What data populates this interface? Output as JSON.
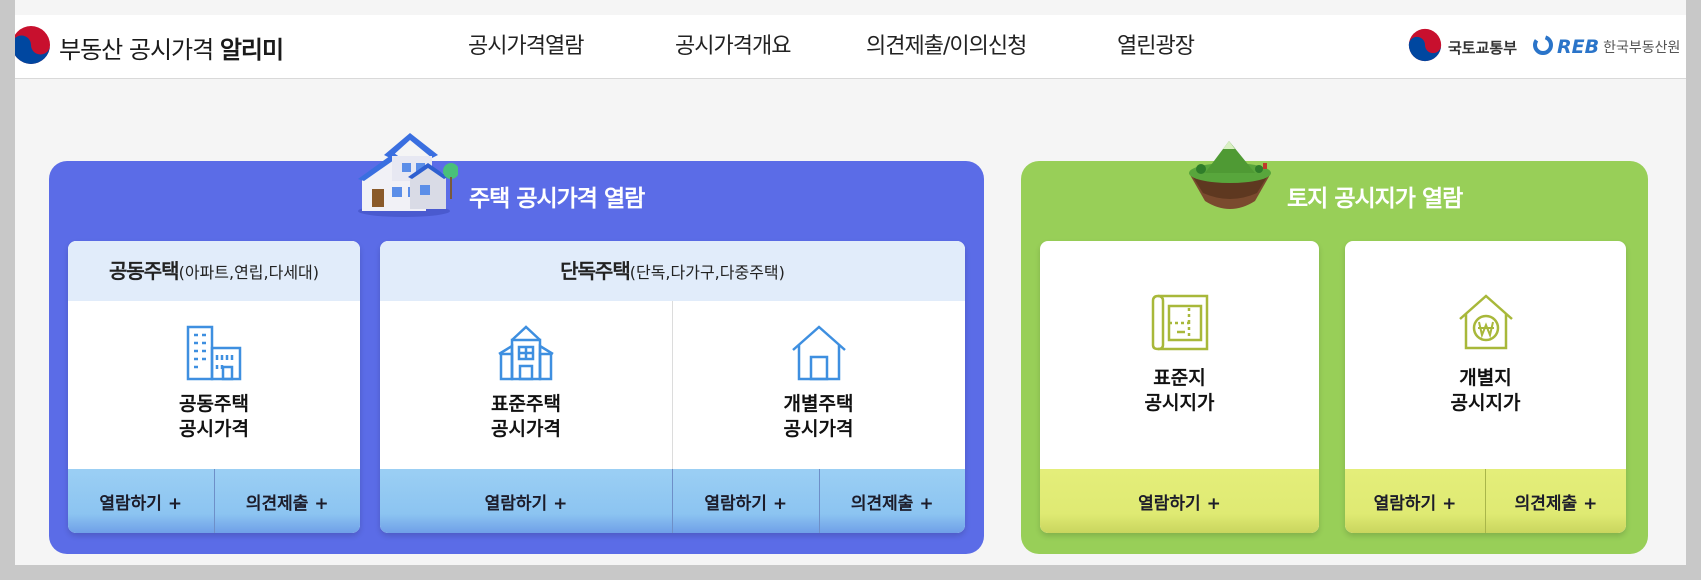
{
  "header": {
    "logo_prefix": "부동산 공시가격",
    "logo_bold": "알리미",
    "nav": [
      "공시가격열람",
      "공시가격개요",
      "의견제출/이의신청",
      "열린광장"
    ],
    "ministry": "국토교통부",
    "reb_mark": "REB",
    "reb_name": "한국부동산원"
  },
  "house_panel": {
    "title": "주택 공시가격 열람",
    "apartment": {
      "title": "공동주택",
      "sub": "(아파트,연립,다세대)",
      "label_line1": "공동주택",
      "label_line2": "공시가격",
      "btn_view": "열람하기 +",
      "btn_opinion": "의견제출 +"
    },
    "detached": {
      "title": "단독주택",
      "sub": "(단독,다가구,다중주택)",
      "standard": {
        "label_line1": "표준주택",
        "label_line2": "공시가격",
        "btn_view": "열람하기 +"
      },
      "individual": {
        "label_line1": "개별주택",
        "label_line2": "공시가격",
        "btn_view": "열람하기 +",
        "btn_opinion": "의견제출 +"
      }
    }
  },
  "land_panel": {
    "title": "토지 공시지가 열람",
    "standard": {
      "label_line1": "표준지",
      "label_line2": "공시지가",
      "btn_view": "열람하기 +"
    },
    "individual": {
      "label_line1": "개별지",
      "label_line2": "공시지가",
      "btn_view": "열람하기 +",
      "btn_opinion": "의견제출 +"
    }
  },
  "colors": {
    "house_panel": "#5b6ce7",
    "land_panel": "#98cf58",
    "blue_button": "#8cc4f1",
    "yellow_button": "#dfea73",
    "card_header": "#e1ecfa",
    "icon_blue": "#3e8fe0",
    "icon_olive": "#a8b83a"
  },
  "icons": {
    "logo": "taegeuk-logo-icon",
    "ministry": "taegeuk-icon",
    "house_illustration": "house-illustration-icon",
    "land_illustration": "floating-island-icon",
    "apartment": "apartment-building-icon",
    "standard_house": "multi-story-house-icon",
    "individual_house": "house-outline-icon",
    "standard_land": "land-map-icon",
    "individual_land": "won-house-icon"
  }
}
